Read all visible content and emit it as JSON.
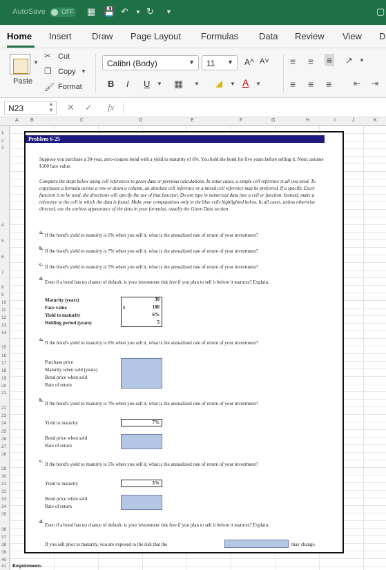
{
  "titlebar": {
    "autosave": "AutoSave",
    "toggle": "OFF",
    "icons": [
      "grid-icon",
      "save-icon",
      "undo-icon",
      "redo-icon",
      "customize-icon"
    ]
  },
  "tabs": [
    "Home",
    "Insert",
    "Draw",
    "Page Layout",
    "Formulas",
    "Data",
    "Review",
    "View",
    "D"
  ],
  "ribbon": {
    "paste": "Paste",
    "cut": "Cut",
    "copy": "Copy",
    "format": "Format",
    "font": "Calibri (Body)",
    "size": "11",
    "increase_font": "A^",
    "decrease_font": "A˅",
    "bold": "B",
    "italic": "I",
    "underline": "U",
    "font_color": "A"
  },
  "formula_bar": {
    "cell": "N23",
    "cancel": "✕",
    "enter": "✓",
    "fx": "fx"
  },
  "columns": [
    "A",
    "B",
    "C",
    "D",
    "E",
    "F",
    "G",
    "H",
    "I",
    "J",
    "K"
  ],
  "rows": [
    "1",
    "2",
    "3",
    "4",
    "5",
    "6",
    "7",
    "8",
    "9",
    "10",
    "11",
    "12",
    "13",
    "14",
    "15",
    "16",
    "17",
    "18",
    "19",
    "20",
    "21",
    "22",
    "23",
    "24",
    "25",
    "26",
    "27",
    "28",
    "29",
    "30",
    "31",
    "32",
    "33",
    "34",
    "35",
    "36",
    "37",
    "38",
    "39",
    "40",
    "41"
  ],
  "problem": {
    "title": "Problem 6-25",
    "intro": "Suppose you purchase a 30-year, zero-coupon bond with a yield to maturity of 6%. You hold the bond for five years before selling it. Note: assume $100 face value.",
    "instructions": "Complete the steps below using cell references to given data or previous calculations. In some cases, a simple cell reference is all you need. To copy/paste a formula across a row or down a column, an absolute cell reference or a mixed cell reference may be preferred. If a specific Excel function is to be used, the directions will specify the use of that function. Do not type in numerical data into a cell or function. Instead, make a reference to the cell in which the data is found. Make your computations only in the blue cells highlighted below. In all cases, unless otherwise directed, use the earliest appearance of the data in your formulas, usually the Given Data section.",
    "questions": [
      {
        "letter": "a.",
        "text": "If the bond's yield to maturity is 6% when you sell it, what is the annualized rate of return of your investment?"
      },
      {
        "letter": "b.",
        "text": "If the bond's yield to maturity is 7% when you sell it, what is the annualized rate of return of your investment?"
      },
      {
        "letter": "c.",
        "text": "If the bond's yield to maturity is 5% when you sell it, what is the annualized rate of return of your investment?"
      },
      {
        "letter": "d.",
        "text": "Even if a bond has no chance of default, is your investment risk free if you plan to sell it before it matures? Explain."
      }
    ],
    "given": {
      "labels": [
        "Maturity (years)",
        "Face value",
        "Yield to maturity",
        "Holding period (years)"
      ],
      "dollar": "$",
      "values": [
        "30",
        "100",
        "6%",
        "5"
      ]
    },
    "part_a": {
      "labels": [
        "Purchase price",
        "Maturity when sold (years)",
        "Bond price when sold",
        "Rate of return"
      ]
    },
    "part_b": {
      "ytm_label": "Yield to maturity",
      "ytm_value": "7%",
      "labels": [
        "Bond price when sold",
        "Rate of return"
      ]
    },
    "part_c": {
      "ytm_label": "Yield to maturity",
      "ytm_value": "5%",
      "labels": [
        "Bond price when sold",
        "Rate of return"
      ]
    },
    "part_d": {
      "prefix": "If you sell prior to maturity, you are exposed to the risk that the",
      "suffix": "may change."
    }
  },
  "footer": {
    "requirements": "Requirements"
  }
}
